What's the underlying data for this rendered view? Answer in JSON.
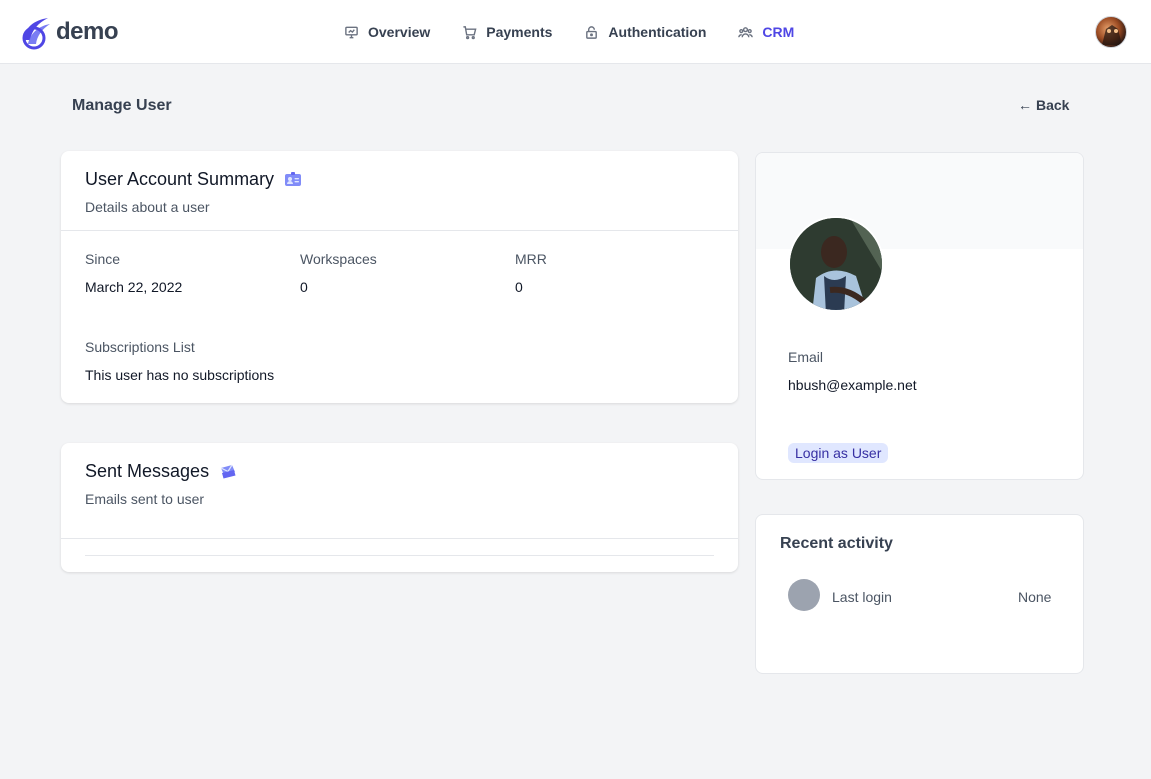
{
  "brand": {
    "name": "demo",
    "accent": "#4f46e5"
  },
  "nav": [
    {
      "label": "Overview",
      "icon": "presentation-icon",
      "active": false
    },
    {
      "label": "Payments",
      "icon": "cart-icon",
      "active": false
    },
    {
      "label": "Authentication",
      "icon": "lock-icon",
      "active": false
    },
    {
      "label": "CRM",
      "icon": "users-icon",
      "active": true
    }
  ],
  "page": {
    "title": "Manage User",
    "back_label": "Back"
  },
  "summary": {
    "title": "User Account Summary",
    "subtitle": "Details about a user",
    "since_label": "Since",
    "since_value": "March 22, 2022",
    "workspaces_label": "Workspaces",
    "workspaces_value": "0",
    "mrr_label": "MRR",
    "mrr_value": "0",
    "subscriptions_label": "Subscriptions List",
    "subscriptions_value": "This user has no subscriptions"
  },
  "messages": {
    "title": "Sent Messages",
    "subtitle": "Emails sent to user"
  },
  "profile": {
    "email_label": "Email",
    "email_value": "hbush@example.net",
    "login_as_label": "Login as User"
  },
  "activity": {
    "title": "Recent activity",
    "item_label": "Last login",
    "item_value": "None"
  }
}
